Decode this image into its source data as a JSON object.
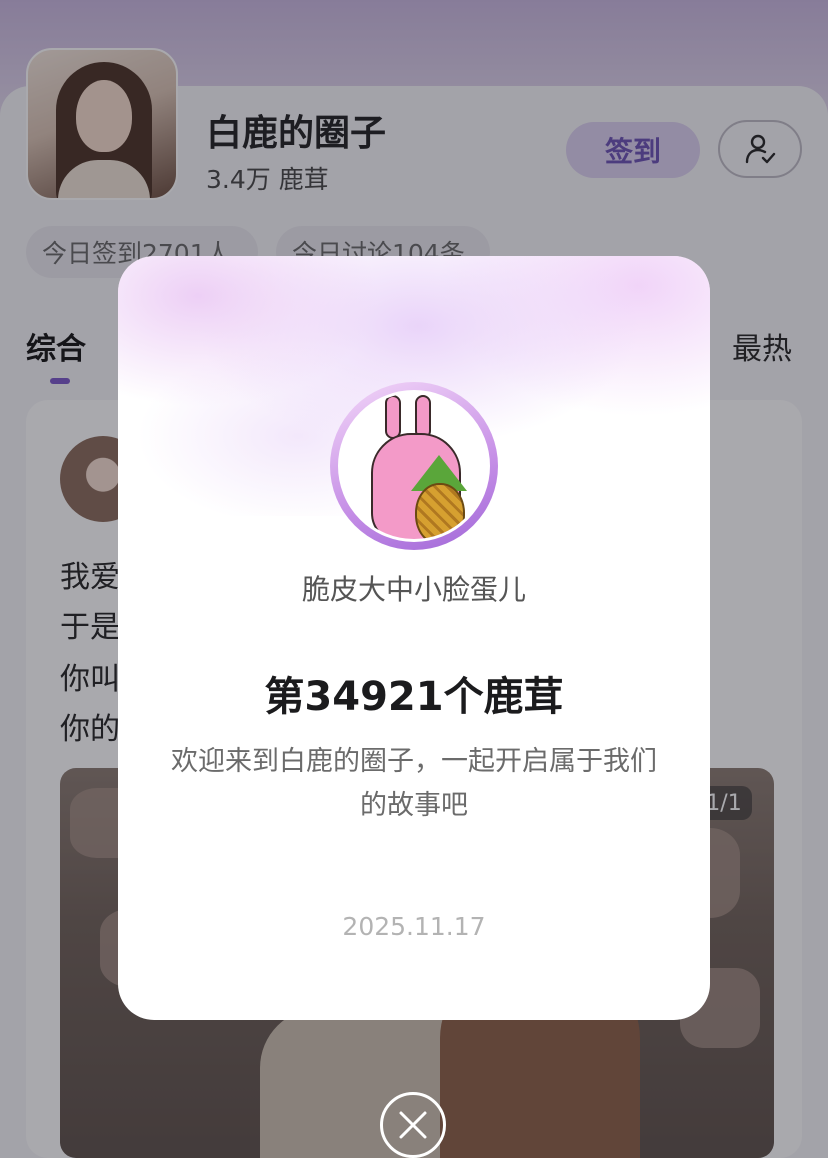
{
  "circle": {
    "title": "白鹿的圈子",
    "members": "3.4万 鹿茸",
    "checkin_label": "签到",
    "stats": [
      "今日签到2701人",
      "今日讨论104条"
    ]
  },
  "tabs": {
    "active": "综合",
    "right": "最热"
  },
  "post": {
    "lines": [
      "我爱",
      "于是",
      "你叫",
      "你的"
    ],
    "image_counter": "1/1"
  },
  "modal": {
    "username": "脆皮大中小脸蛋儿",
    "rank": "第34921个鹿茸",
    "welcome": "欢迎来到白鹿的圈子，一起开启属于我们的故事吧",
    "date": "2025.11.17"
  },
  "icons": {
    "profile": "user-check-icon",
    "close": "close-icon"
  },
  "colors": {
    "accent": "#7a56c8",
    "checkin_bg": "#dcd0f0",
    "checkin_text": "#6a4fb3"
  }
}
